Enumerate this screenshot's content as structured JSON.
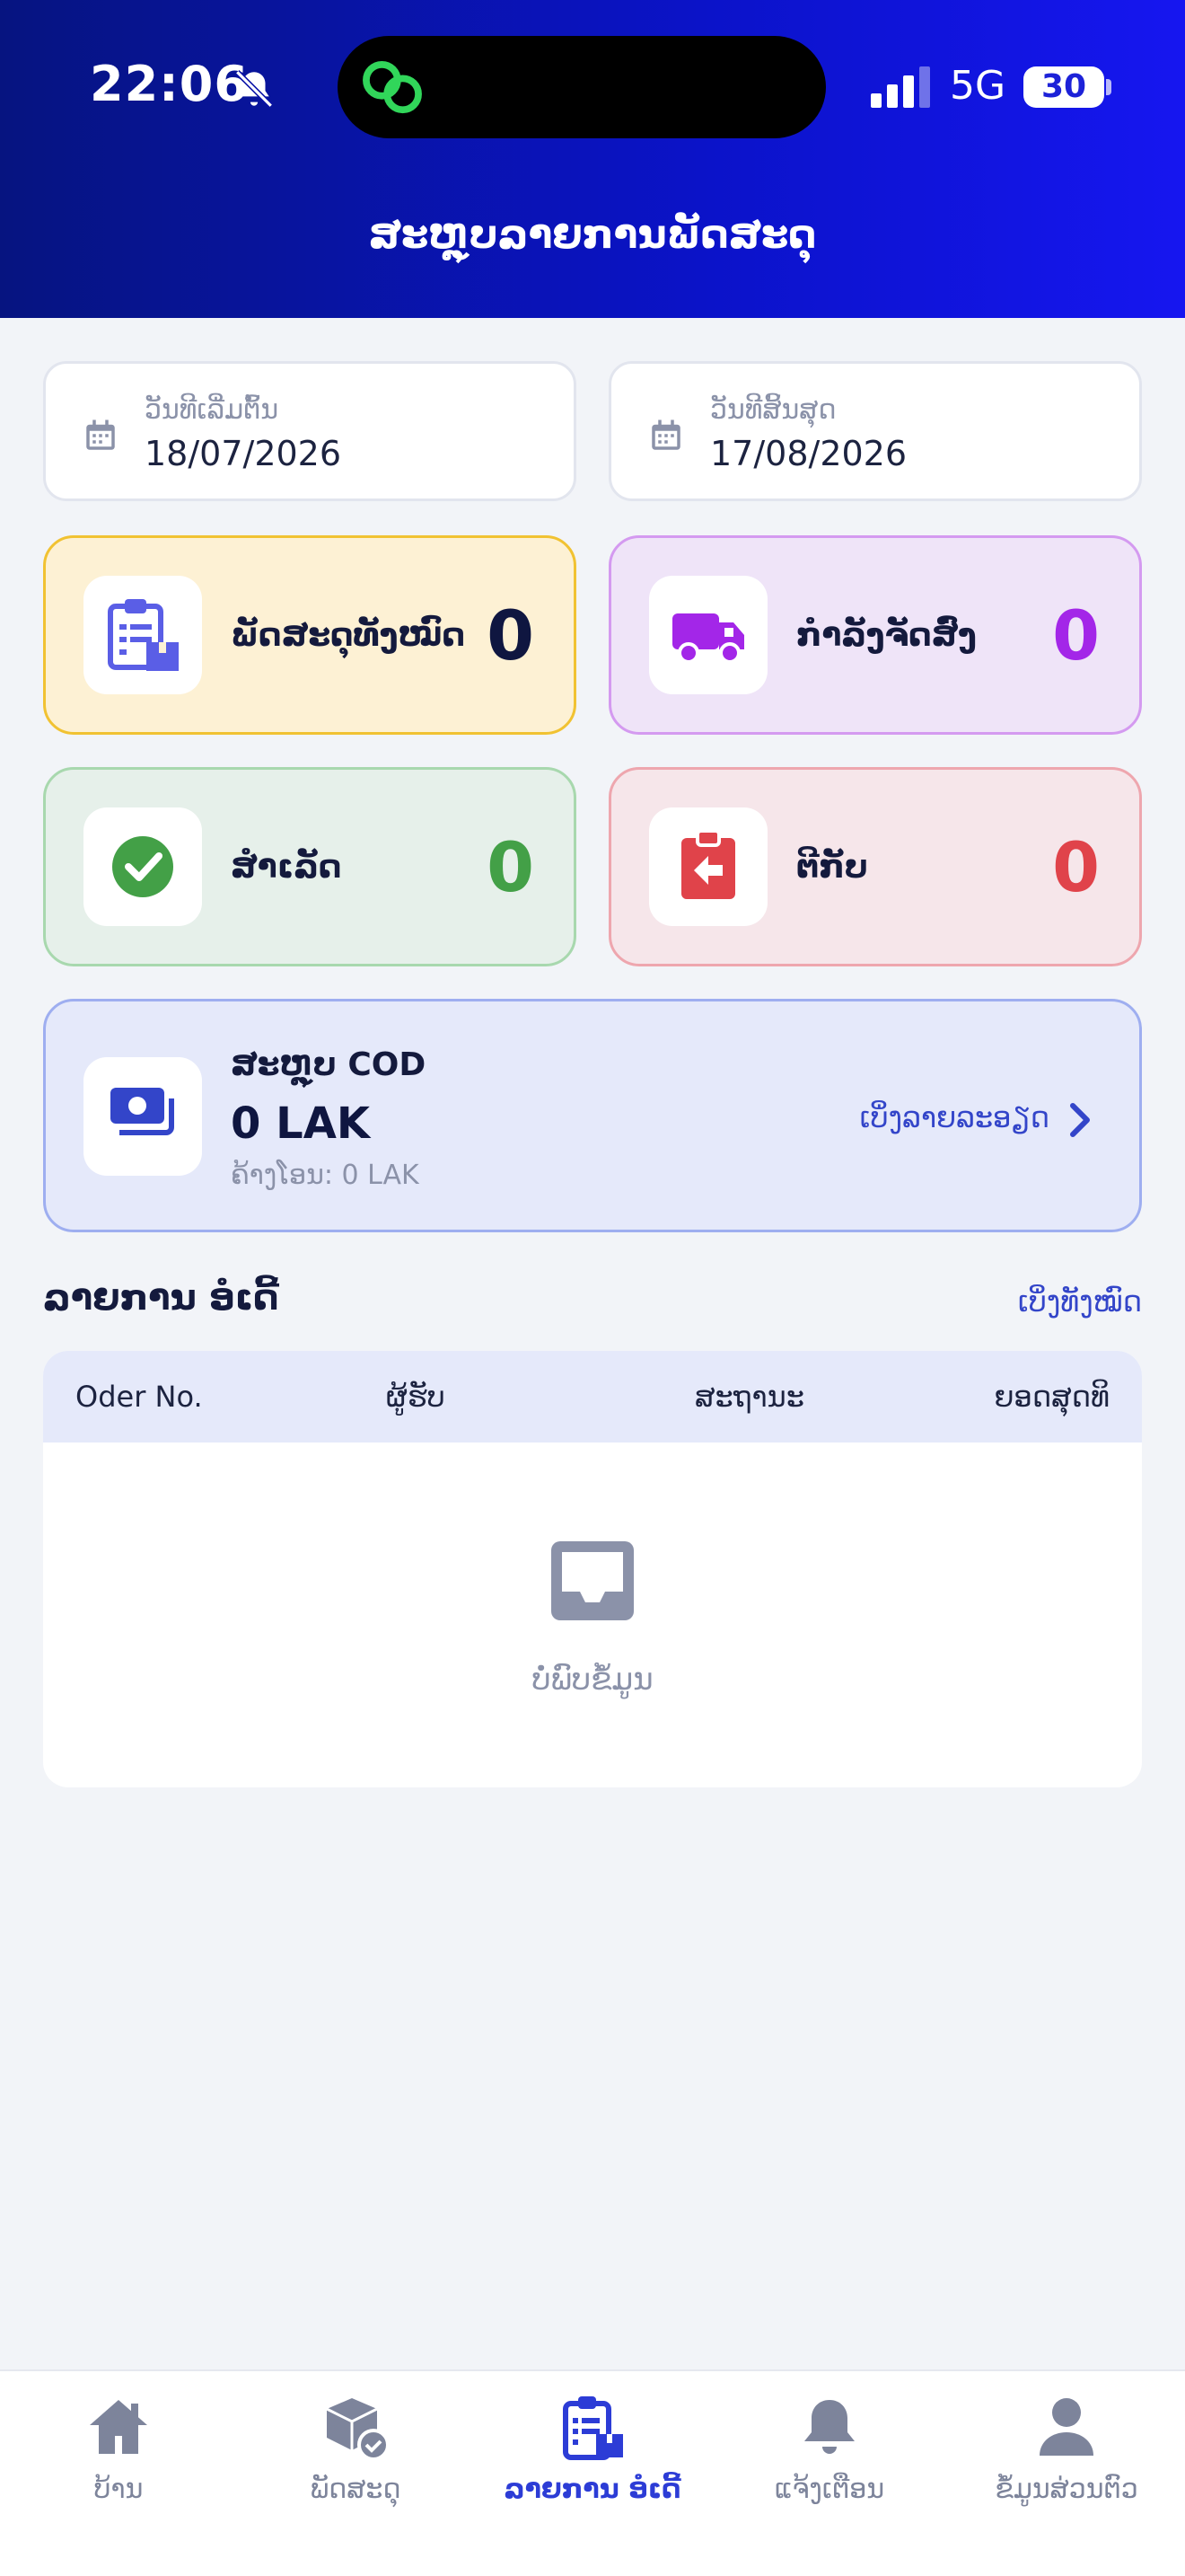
{
  "status_bar": {
    "time": "22:06",
    "network": "5G",
    "battery": "30"
  },
  "header": {
    "title": "ສະຫຼຸບລາຍການພັດສະດຸ"
  },
  "dates": {
    "start_label": "ວັນທີເລີ່ມຕົ້ນ",
    "start_value": "18/07/2026",
    "end_label": "ວັນທີສິ້ນສຸດ",
    "end_value": "17/08/2026"
  },
  "stats": [
    {
      "title": "ພັດສະດຸທັງໝົດ",
      "count": "0",
      "icon": "clipboard-box-icon",
      "color": "#0f1640",
      "bg": "#fdf1d4",
      "border": "#f1c232"
    },
    {
      "title": "ກຳລັງຈັດສົ່ງ",
      "count": "0",
      "icon": "truck-icon",
      "color": "#a326e8",
      "bg": "#efe4f8",
      "border": "#d49af0"
    },
    {
      "title": "ສຳເລັດ",
      "count": "0",
      "icon": "check-circle-icon",
      "color": "#43a047",
      "bg": "#e6f0ea",
      "border": "#a8d8ae"
    },
    {
      "title": "ຕີກັບ",
      "count": "0",
      "icon": "return-clipboard-icon",
      "color": "#e0434a",
      "bg": "#f6e6ea",
      "border": "#eea6ae"
    }
  ],
  "cod": {
    "title": "ສະຫຼຸບ COD",
    "amount": "0 LAK",
    "pending": "ຄ້າງໂອນ: 0 LAK",
    "details_link": "ເບິ່ງລາຍລະອຽດ"
  },
  "orders": {
    "title": "ລາຍການ ອໍເດີ້",
    "see_all": "ເບິ່ງທັງໝົດ",
    "columns": [
      "Oder No.",
      "ຜູ້ຮັບ",
      "ສະຖານະ",
      "ຍອດສຸດທິ"
    ],
    "empty_text": "ບໍ່ພົບຂໍ້ມູນ"
  },
  "nav": [
    {
      "label": "ບ້ານ",
      "icon": "home-icon",
      "active": false
    },
    {
      "label": "ພັດສະດຸ",
      "icon": "package-check-icon",
      "active": false
    },
    {
      "label": "ລາຍການ ອໍເດີ້",
      "icon": "clipboard-list-icon",
      "active": true
    },
    {
      "label": "ແຈ້ງເຕືອນ",
      "icon": "bell-icon",
      "active": false
    },
    {
      "label": "ຂໍ້ມູນສ່ວນຕົວ",
      "icon": "user-icon",
      "active": false
    }
  ],
  "colors": {
    "header_gradient_start": "#061480",
    "header_gradient_end": "#1616f0",
    "accent": "#2c3cd6",
    "card_cod_bg": "#e5e9fa"
  }
}
